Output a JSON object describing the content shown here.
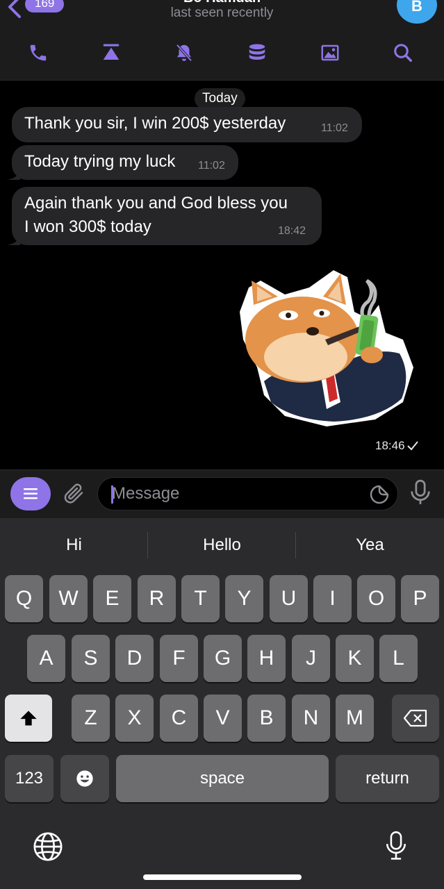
{
  "header": {
    "back_count": "169",
    "title": "Bo Hamdan",
    "subtitle": "last seen recently",
    "avatar_letter": "B",
    "toolbar_icons": [
      "phone-icon",
      "pin-top-icon",
      "mute-bell-icon",
      "storage-icon",
      "media-icon",
      "search-icon"
    ]
  },
  "chat": {
    "date": "Today",
    "messages": [
      {
        "text": "Thank you sir,  I win 200$ yesterday",
        "time": "11:02"
      },
      {
        "text": "Today trying my luck",
        "time": "11:02"
      },
      {
        "text_line1": "Again thank you and God bless you",
        "text_line2": "I won 300$ today",
        "time": "18:42"
      }
    ],
    "sticker": {
      "name": "shiba-businessman-sticker",
      "time": "18:46",
      "status": "sent"
    }
  },
  "input": {
    "placeholder": "Message"
  },
  "keyboard": {
    "suggestions": [
      "Hi",
      "Hello",
      "Yea"
    ],
    "row1": [
      "Q",
      "W",
      "E",
      "R",
      "T",
      "Y",
      "U",
      "I",
      "O",
      "P"
    ],
    "row2": [
      "A",
      "S",
      "D",
      "F",
      "G",
      "H",
      "J",
      "K",
      "L"
    ],
    "row3": [
      "Z",
      "X",
      "C",
      "V",
      "B",
      "N",
      "M"
    ],
    "numbers_label": "123",
    "space_label": "space",
    "return_label": "return"
  },
  "colors": {
    "accent": "#8e74e6",
    "bubble": "#262628",
    "header_bg": "#1c1c1d",
    "keyboard_bg": "#2b2b2d",
    "key": "#6d6d70",
    "avatar": "#3ea6ec"
  }
}
